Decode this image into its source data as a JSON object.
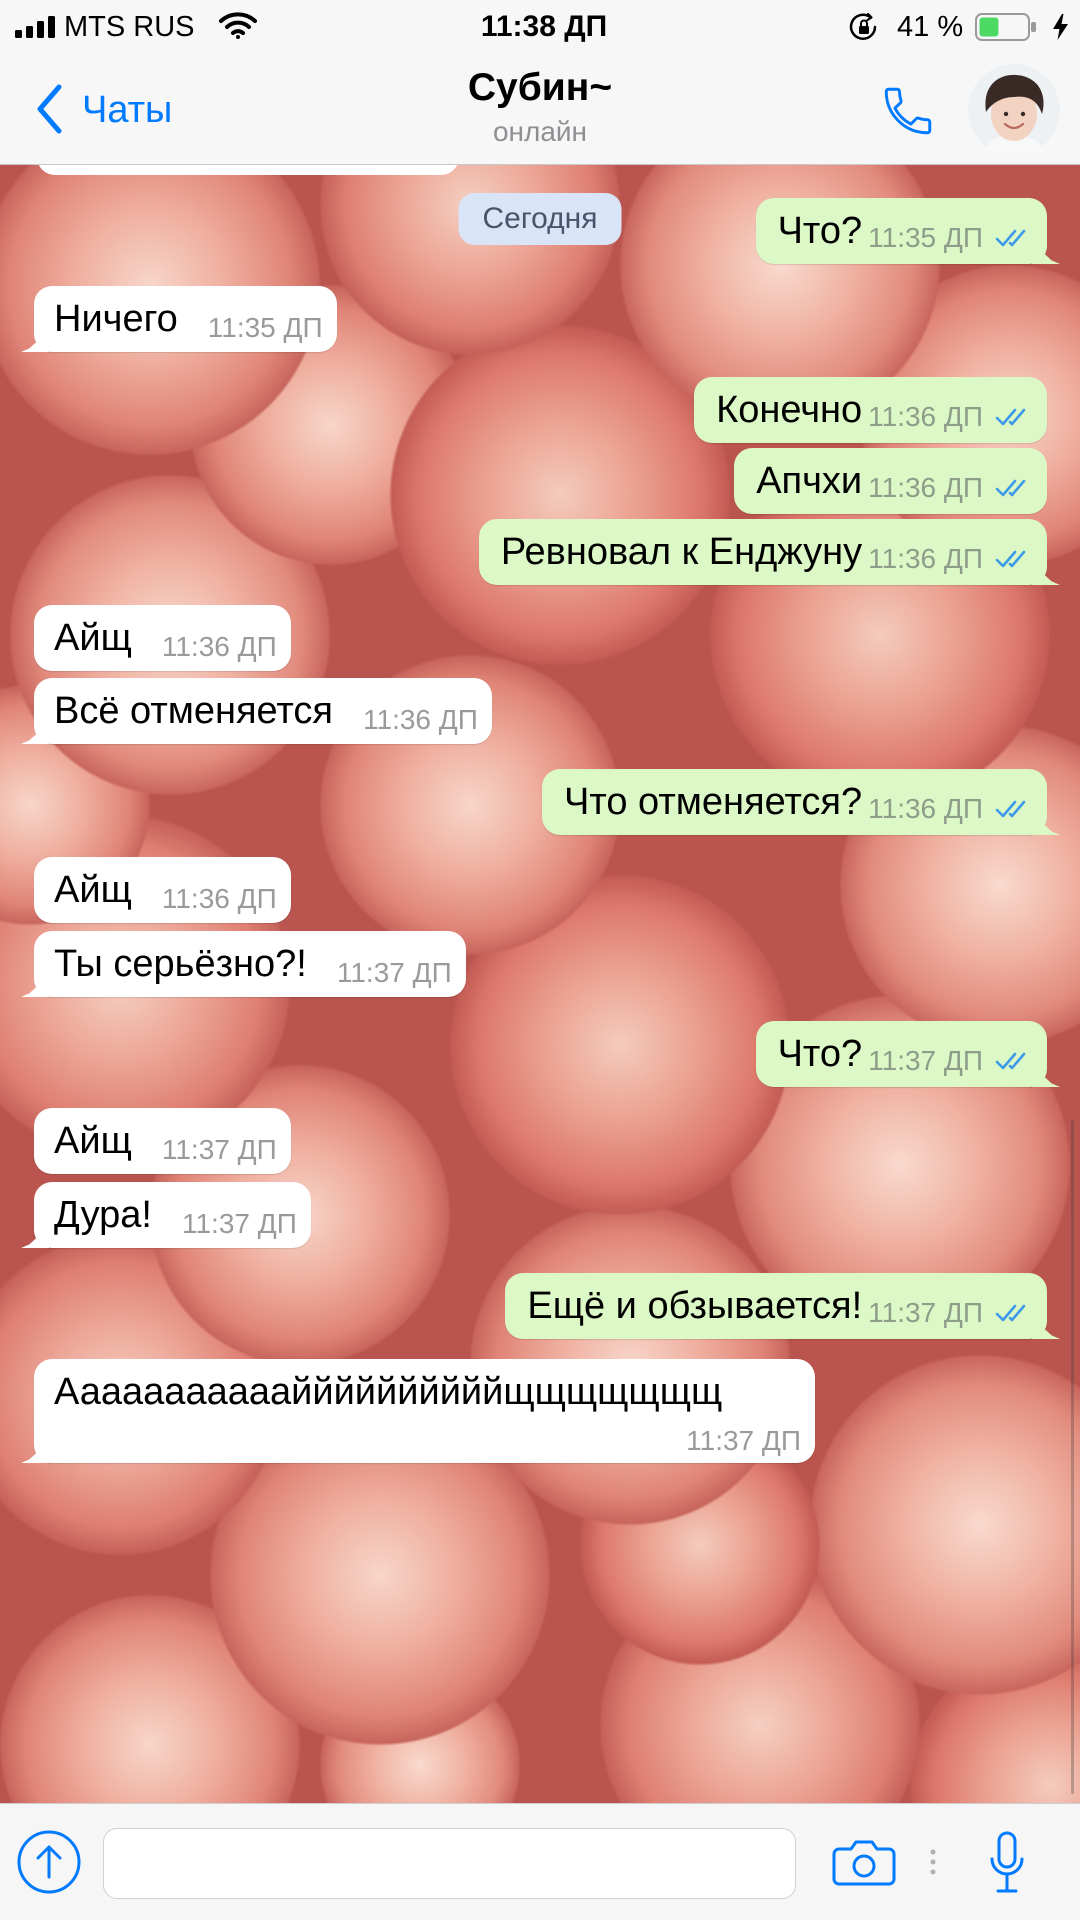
{
  "status_bar": {
    "carrier": "MTS RUS",
    "time": "11:38 ДП",
    "battery_percent": "41 %",
    "battery_level": 0.41,
    "icons": [
      "signal-icon",
      "wifi-icon",
      "orientation-lock-icon",
      "battery-icon",
      "charging-bolt-icon"
    ]
  },
  "header": {
    "back_label": "Чаты",
    "title": "Субин~",
    "subtitle": "онлайн",
    "icons": [
      "chevron-left-icon",
      "phone-icon",
      "avatar"
    ]
  },
  "chat": {
    "date_label": "Сегодня",
    "messages": [
      {
        "outgoing": true,
        "text": "Что?",
        "time": "11:35 ДП",
        "read": true
      },
      {
        "outgoing": false,
        "text": "Ничего",
        "time": "11:35 ДП"
      },
      {
        "outgoing": true,
        "text": "Конечно",
        "time": "11:36 ДП",
        "read": true
      },
      {
        "outgoing": true,
        "text": "Апчхи",
        "time": "11:36 ДП",
        "read": true
      },
      {
        "outgoing": true,
        "text": "Ревновал к Енджуну",
        "time": "11:36 ДП",
        "read": true
      },
      {
        "outgoing": false,
        "text": "Айщ",
        "time": "11:36 ДП"
      },
      {
        "outgoing": false,
        "text": "Всё отменяется",
        "time": "11:36 ДП"
      },
      {
        "outgoing": true,
        "text": "Что отменяется?",
        "time": "11:36 ДП",
        "read": true
      },
      {
        "outgoing": false,
        "text": "Айщ",
        "time": "11:36 ДП"
      },
      {
        "outgoing": false,
        "text": "Ты серьёзно?!",
        "time": "11:37 ДП"
      },
      {
        "outgoing": true,
        "text": "Что?",
        "time": "11:37 ДП",
        "read": true
      },
      {
        "outgoing": false,
        "text": "Айщ",
        "time": "11:37 ДП"
      },
      {
        "outgoing": false,
        "text": "Дура!",
        "time": "11:37 ДП"
      },
      {
        "outgoing": true,
        "text": "Ещё и обзывается!",
        "time": "11:37 ДП",
        "read": true
      },
      {
        "outgoing": false,
        "text": "Аааааааааааййййййййййщщщщщщщ",
        "time": "11:37 ДП"
      }
    ]
  },
  "composer": {
    "icons": [
      "upload-icon",
      "camera-icon",
      "more-dots-icon",
      "microphone-icon"
    ]
  },
  "colors": {
    "accent": "#007aff",
    "outgoing_bubble": "#dcf8c6",
    "incoming_bubble": "#ffffff",
    "read_check": "#3d9ae8",
    "battery": "#4cd964"
  }
}
